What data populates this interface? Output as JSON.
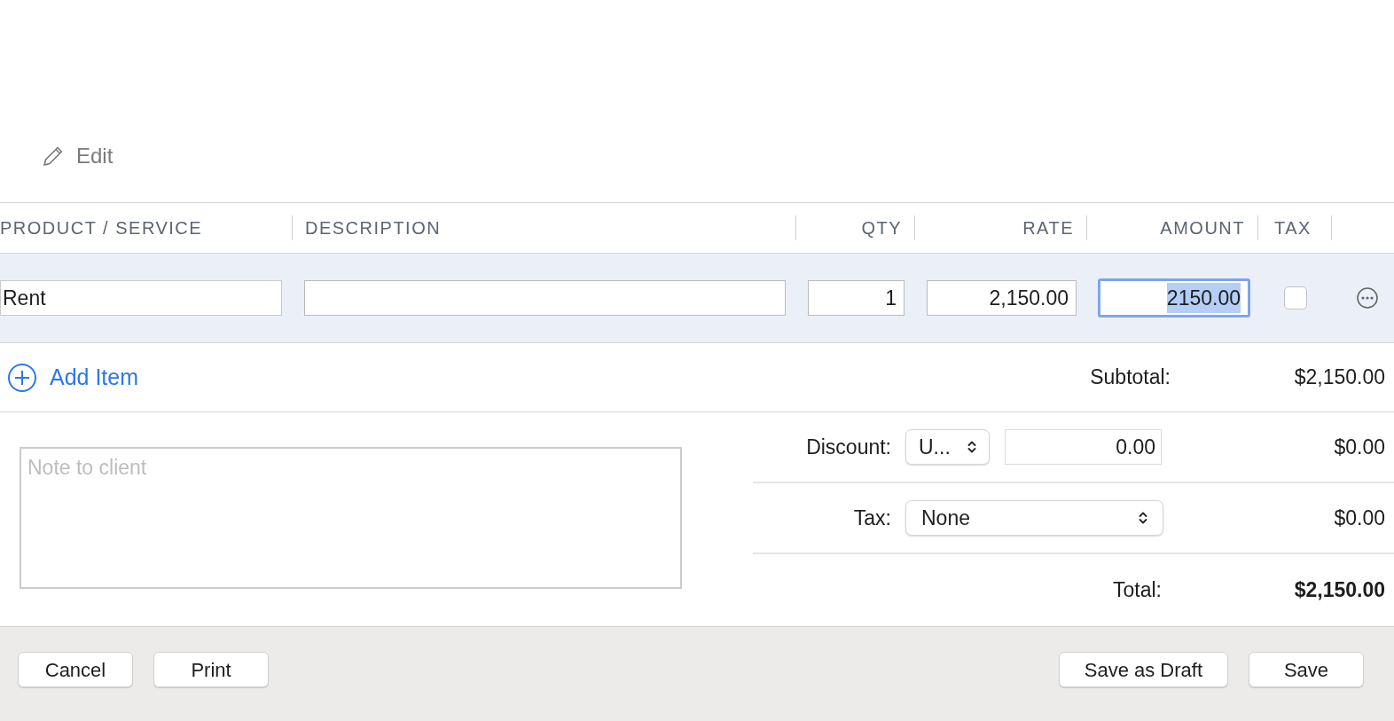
{
  "edit_link": "Edit",
  "columns": [
    "PRODUCT / SERVICE",
    "DESCRIPTION",
    "QTY",
    "RATE",
    "AMOUNT",
    "TAX"
  ],
  "line_item": {
    "product": "Rent",
    "qty": "1",
    "rate": "2,150.00",
    "amount": "2150.00",
    "amount_focused": true,
    "taxable": false
  },
  "add_item": "Add Item",
  "subtotal": {
    "label": "Subtotal:",
    "value": "$2,150.00"
  },
  "note": {
    "placeholder": "Note to client"
  },
  "discount": {
    "label": "Discount:",
    "type": "U...",
    "amount": "0.00",
    "value": "$0.00"
  },
  "tax": {
    "label": "Tax:",
    "rate": "None",
    "value": "$0.00"
  },
  "total": {
    "label": "Total:",
    "value": "$2,150.00"
  },
  "footer_left": [
    "Cancel",
    "Print"
  ],
  "footer_right": [
    "Save as Draft",
    "Save"
  ]
}
